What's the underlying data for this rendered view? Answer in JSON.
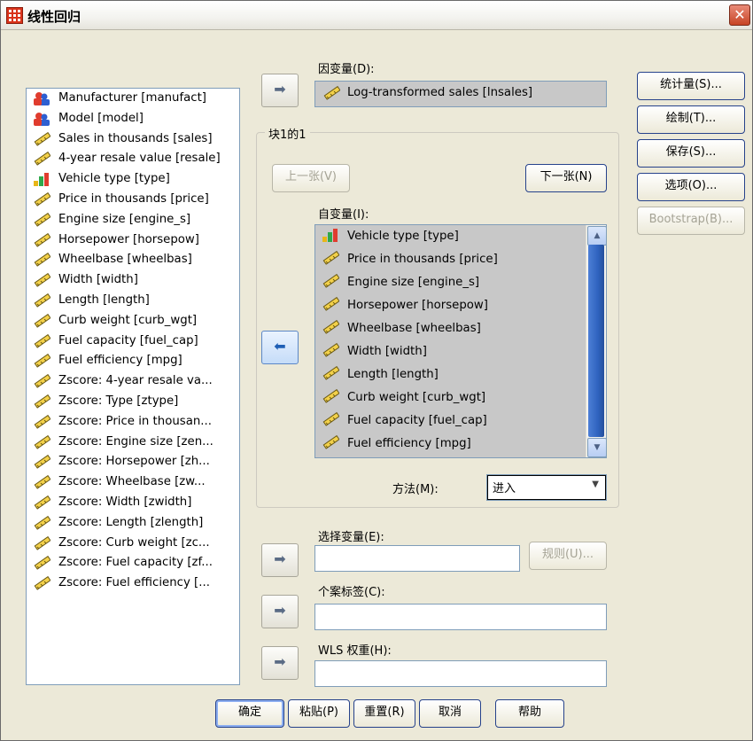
{
  "window": {
    "title": "线性回归",
    "close_glyph": "✕"
  },
  "source_variables": [
    {
      "label": "Manufacturer [manufact]",
      "icon": "nominal-icon"
    },
    {
      "label": "Model [model]",
      "icon": "nominal-icon"
    },
    {
      "label": "Sales in thousands [sales]",
      "icon": "scale-icon"
    },
    {
      "label": "4-year resale value [resale]",
      "icon": "scale-icon"
    },
    {
      "label": "Vehicle type [type]",
      "icon": "ordinal-icon"
    },
    {
      "label": "Price in thousands [price]",
      "icon": "scale-icon"
    },
    {
      "label": "Engine size [engine_s]",
      "icon": "scale-icon"
    },
    {
      "label": "Horsepower [horsepow]",
      "icon": "scale-icon"
    },
    {
      "label": "Wheelbase [wheelbas]",
      "icon": "scale-icon"
    },
    {
      "label": "Width [width]",
      "icon": "scale-icon"
    },
    {
      "label": "Length [length]",
      "icon": "scale-icon"
    },
    {
      "label": "Curb weight [curb_wgt]",
      "icon": "scale-icon"
    },
    {
      "label": "Fuel capacity [fuel_cap]",
      "icon": "scale-icon"
    },
    {
      "label": "Fuel efficiency [mpg]",
      "icon": "scale-icon"
    },
    {
      "label": "Zscore:  4-year resale va...",
      "icon": "scale-icon"
    },
    {
      "label": "Zscore:  Type [ztype]",
      "icon": "scale-icon"
    },
    {
      "label": "Zscore:  Price in thousan...",
      "icon": "scale-icon"
    },
    {
      "label": "Zscore:  Engine size [zen...",
      "icon": "scale-icon"
    },
    {
      "label": "Zscore:  Horsepower [zh...",
      "icon": "scale-icon"
    },
    {
      "label": "Zscore:  Wheelbase [zw...",
      "icon": "scale-icon"
    },
    {
      "label": "Zscore:  Width [zwidth]",
      "icon": "scale-icon"
    },
    {
      "label": "Zscore:  Length [zlength]",
      "icon": "scale-icon"
    },
    {
      "label": "Zscore:  Curb weight [zc...",
      "icon": "scale-icon"
    },
    {
      "label": "Zscore:  Fuel capacity [zf...",
      "icon": "scale-icon"
    },
    {
      "label": "Zscore:  Fuel efficiency [..."
    }
  ],
  "dependent": {
    "label": "因变量(D):",
    "value": "Log-transformed sales [lnsales]",
    "icon": "scale-icon"
  },
  "block": {
    "label": "块1的1",
    "prev_label": "上一张(V)",
    "next_label": "下一张(N)"
  },
  "independents": {
    "label": "自变量(I):",
    "items": [
      {
        "label": "Vehicle type [type]",
        "icon": "ordinal-icon"
      },
      {
        "label": "Price in thousands [price]",
        "icon": "scale-icon"
      },
      {
        "label": "Engine size [engine_s]",
        "icon": "scale-icon"
      },
      {
        "label": "Horsepower [horsepow]",
        "icon": "scale-icon"
      },
      {
        "label": "Wheelbase [wheelbas]",
        "icon": "scale-icon"
      },
      {
        "label": "Width [width]",
        "icon": "scale-icon"
      },
      {
        "label": "Length [length]",
        "icon": "scale-icon"
      },
      {
        "label": "Curb weight [curb_wgt]",
        "icon": "scale-icon"
      },
      {
        "label": "Fuel capacity [fuel_cap]",
        "icon": "scale-icon"
      },
      {
        "label": "Fuel efficiency [mpg]",
        "icon": "scale-icon"
      }
    ]
  },
  "method": {
    "label": "方法(M):",
    "value": "进入"
  },
  "selection": {
    "label": "选择变量(E):",
    "value": "",
    "rule_label": "规则(U)..."
  },
  "case_labels": {
    "label": "个案标签(C):",
    "value": ""
  },
  "wls": {
    "label": "WLS 权重(H):",
    "value": ""
  },
  "side_buttons": {
    "statistics": "统计量(S)...",
    "plots": "绘制(T)...",
    "save": "保存(S)...",
    "options": "选项(O)...",
    "bootstrap": "Bootstrap(B)..."
  },
  "bottom_buttons": {
    "ok": "确定",
    "paste": "粘贴(P)",
    "reset": "重置(R)",
    "cancel": "取消",
    "help": "帮助"
  },
  "arrow_glyphs": {
    "right": "➡",
    "left": "⬅"
  },
  "dropdown_glyph": "▼",
  "colors": {
    "selection_bg": "#c8c8c8",
    "dialog_bg": "#ece9d8",
    "accent": "#2f63bf"
  }
}
